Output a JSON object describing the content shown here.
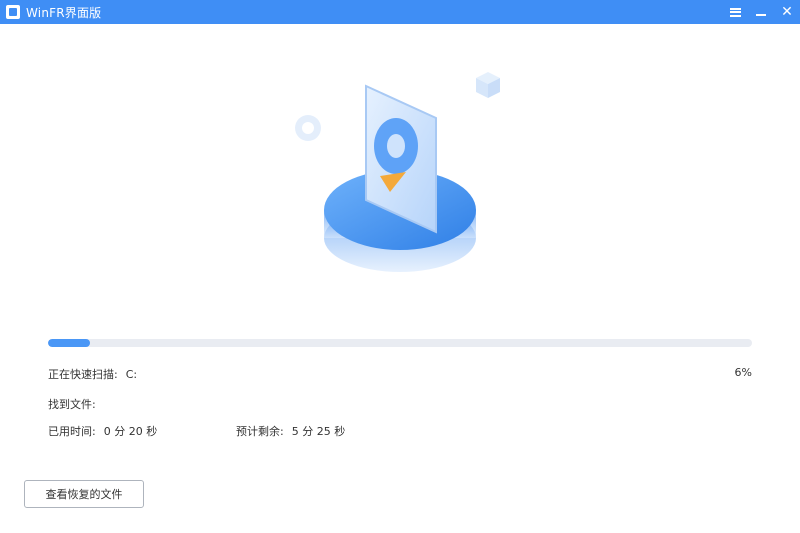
{
  "window": {
    "title": "WinFR界面版"
  },
  "scan": {
    "label": "正在快速扫描:",
    "drive": "C:",
    "progress_text": "6%",
    "progress_fraction": 0.06
  },
  "found": {
    "label": "找到文件:"
  },
  "elapsed": {
    "label": "已用时间:",
    "value": "0 分 20 秒"
  },
  "remaining": {
    "label": "预计剩余:",
    "value": "5 分 25 秒"
  },
  "actions": {
    "view_recovered_label": "查看恢复的文件"
  },
  "colors": {
    "accent": "#3f8ef5",
    "progress": "#4a97f6",
    "track": "#e9ecf2"
  },
  "icons": {
    "app": "winfr-app-icon",
    "menu": "hamburger-menu-icon",
    "minimize": "minimize-icon",
    "close": "close-icon",
    "illustration": "hard-drive-scan-illustration"
  }
}
